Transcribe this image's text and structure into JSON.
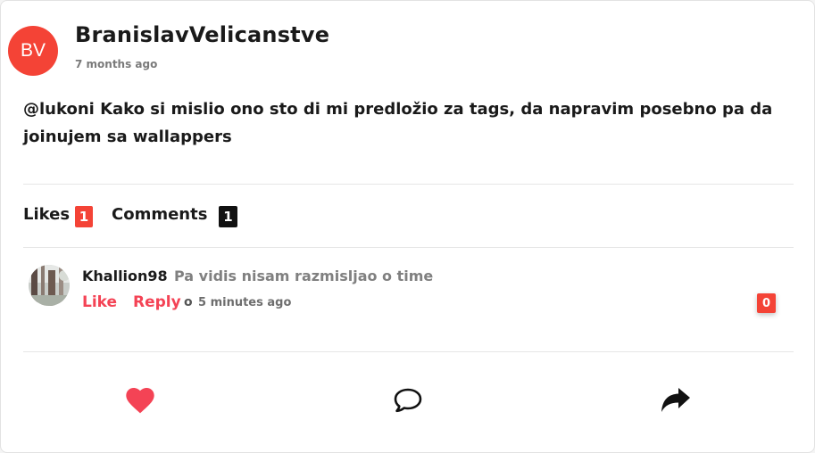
{
  "post": {
    "avatar_initials": "BV",
    "avatar_color": "#f44336",
    "author": "BranislavVelicanstve",
    "time": "7 months ago",
    "text": "@lukoni Kako si mislio ono sto di mi predložio za tags, da napravim posebno pa da joinujem sa wallappers"
  },
  "stats": {
    "likes_label": "Likes",
    "likes_count": "1",
    "comments_label": "Comments",
    "comments_count": "1"
  },
  "comment": {
    "author": "Khallion98",
    "text": "Pa vidis nisam razmisljao o time",
    "like_label": "Like",
    "reply_label": "Reply",
    "separator": "o",
    "time": "5 minutes ago",
    "like_count": "0"
  },
  "actions": {
    "like_icon": "heart-icon",
    "comment_icon": "comment-bubble-icon",
    "share_icon": "share-arrow-icon"
  },
  "colors": {
    "accent_red": "#f44336",
    "link_red": "#f44355",
    "dark": "#1a1a1a",
    "muted": "#808080"
  }
}
